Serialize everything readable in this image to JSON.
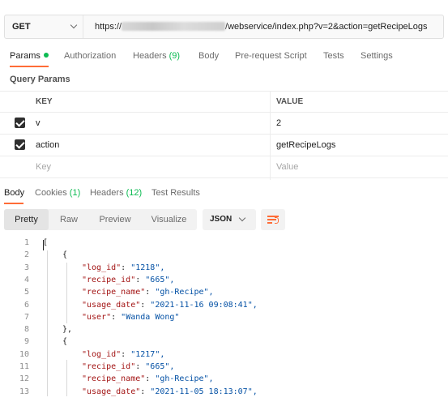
{
  "request": {
    "method": "GET",
    "url_prefix": "https://",
    "url_suffix": "/webservice/index.php?v=2&action=getRecipeLogs"
  },
  "request_tabs": [
    {
      "label": "Params",
      "count": ""
    },
    {
      "label": "Authorization",
      "count": ""
    },
    {
      "label": "Headers ",
      "count": "(9)"
    },
    {
      "label": "Body",
      "count": ""
    },
    {
      "label": "Pre-request Script",
      "count": ""
    },
    {
      "label": "Tests",
      "count": ""
    },
    {
      "label": "Settings",
      "count": ""
    }
  ],
  "query_params": {
    "title": "Query Params",
    "headers": {
      "key": "KEY",
      "value": "VALUE"
    },
    "rows": [
      {
        "key": "v",
        "value": "2",
        "checked": true
      },
      {
        "key": "action",
        "value": "getRecipeLogs",
        "checked": true
      }
    ],
    "placeholder": {
      "key": "Key",
      "value": "Value"
    }
  },
  "response_tabs": [
    {
      "label": "Body",
      "count": ""
    },
    {
      "label": "Cookies ",
      "count": "(1)"
    },
    {
      "label": "Headers ",
      "count": "(12)"
    },
    {
      "label": "Test Results",
      "count": ""
    }
  ],
  "format_tabs": [
    "Pretty",
    "Raw",
    "Preview",
    "Visualize"
  ],
  "format_active": "Pretty",
  "language": "JSON",
  "code_lines": [
    {
      "n": "1",
      "indent": 0,
      "text": "["
    },
    {
      "n": "2",
      "indent": 1,
      "text": "{"
    },
    {
      "n": "3",
      "indent": 2,
      "key": "\"log_id\"",
      "value": "\"1218\","
    },
    {
      "n": "4",
      "indent": 2,
      "key": "\"recipe_id\"",
      "value": "\"665\","
    },
    {
      "n": "5",
      "indent": 2,
      "key": "\"recipe_name\"",
      "value": "\"gh-Recipe\","
    },
    {
      "n": "6",
      "indent": 2,
      "key": "\"usage_date\"",
      "value": "\"2021-11-16 09:08:41\","
    },
    {
      "n": "7",
      "indent": 2,
      "key": "\"user\"",
      "value": "\"Wanda Wong\""
    },
    {
      "n": "8",
      "indent": 1,
      "text": "},"
    },
    {
      "n": "9",
      "indent": 1,
      "text": "{"
    },
    {
      "n": "10",
      "indent": 2,
      "key": "\"log_id\"",
      "value": "\"1217\","
    },
    {
      "n": "11",
      "indent": 2,
      "key": "\"recipe_id\"",
      "value": "\"665\","
    },
    {
      "n": "12",
      "indent": 2,
      "key": "\"recipe_name\"",
      "value": "\"gh-Recipe\","
    },
    {
      "n": "13",
      "indent": 2,
      "key": "\"usage_date\"",
      "value": "\"2021-11-05 18:13:07\","
    }
  ],
  "colors": {
    "accent": "#ff6c37",
    "status_green": "#0cbb52"
  },
  "icons": {
    "method_dropdown": "chevron-down-icon",
    "language_dropdown": "chevron-down-icon",
    "wrap": "wrap-lines-icon",
    "checkbox": "checkbox-checked-icon"
  }
}
